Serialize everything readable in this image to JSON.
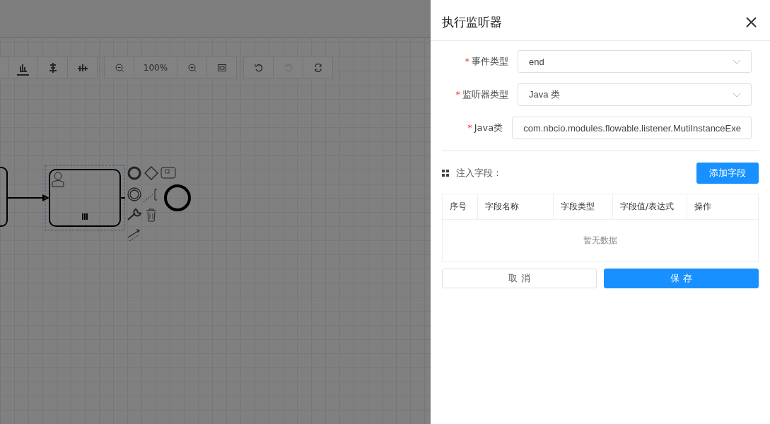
{
  "toolbar": {
    "groups": [
      {
        "buttons": [
          {
            "kind": "align-bottom",
            "selected": true,
            "disabled": false
          },
          {
            "kind": "align-center",
            "selected": false,
            "disabled": false
          },
          {
            "kind": "distribute",
            "selected": false,
            "disabled": false
          }
        ]
      },
      {
        "buttons": [
          {
            "kind": "zoom-out",
            "selected": false,
            "disabled": false
          },
          {
            "kind": "zoom-level",
            "label": "100%",
            "selected": false,
            "disabled": false
          },
          {
            "kind": "zoom-in",
            "selected": false,
            "disabled": false
          },
          {
            "kind": "fit",
            "selected": false,
            "disabled": false
          }
        ]
      },
      {
        "buttons": [
          {
            "kind": "undo",
            "selected": false,
            "disabled": false
          },
          {
            "kind": "redo",
            "selected": false,
            "disabled": true
          },
          {
            "kind": "reset",
            "selected": false,
            "disabled": false
          }
        ]
      }
    ]
  },
  "drawer": {
    "title": "执行监听器",
    "fields": [
      {
        "label": "事件类型",
        "required_mark": "*",
        "kind": "select",
        "value": "end"
      },
      {
        "label": "监听器类型",
        "required_mark": "*",
        "kind": "select",
        "value": "Java 类"
      },
      {
        "label": "Java类",
        "required_mark": "*",
        "kind": "input",
        "value": "com.nbcio.modules.flowable.listener.MutiInstanceExe"
      }
    ],
    "section_title": "注入字段：",
    "add_button": "添加字段",
    "table": {
      "columns": [
        "序号",
        "字段名称",
        "字段类型",
        "字段值/表达式",
        "操作"
      ],
      "empty_text": "暂无数据"
    },
    "buttons": [
      {
        "kind": "default",
        "label": "取 消"
      },
      {
        "kind": "primary",
        "label": "保 存"
      }
    ]
  }
}
